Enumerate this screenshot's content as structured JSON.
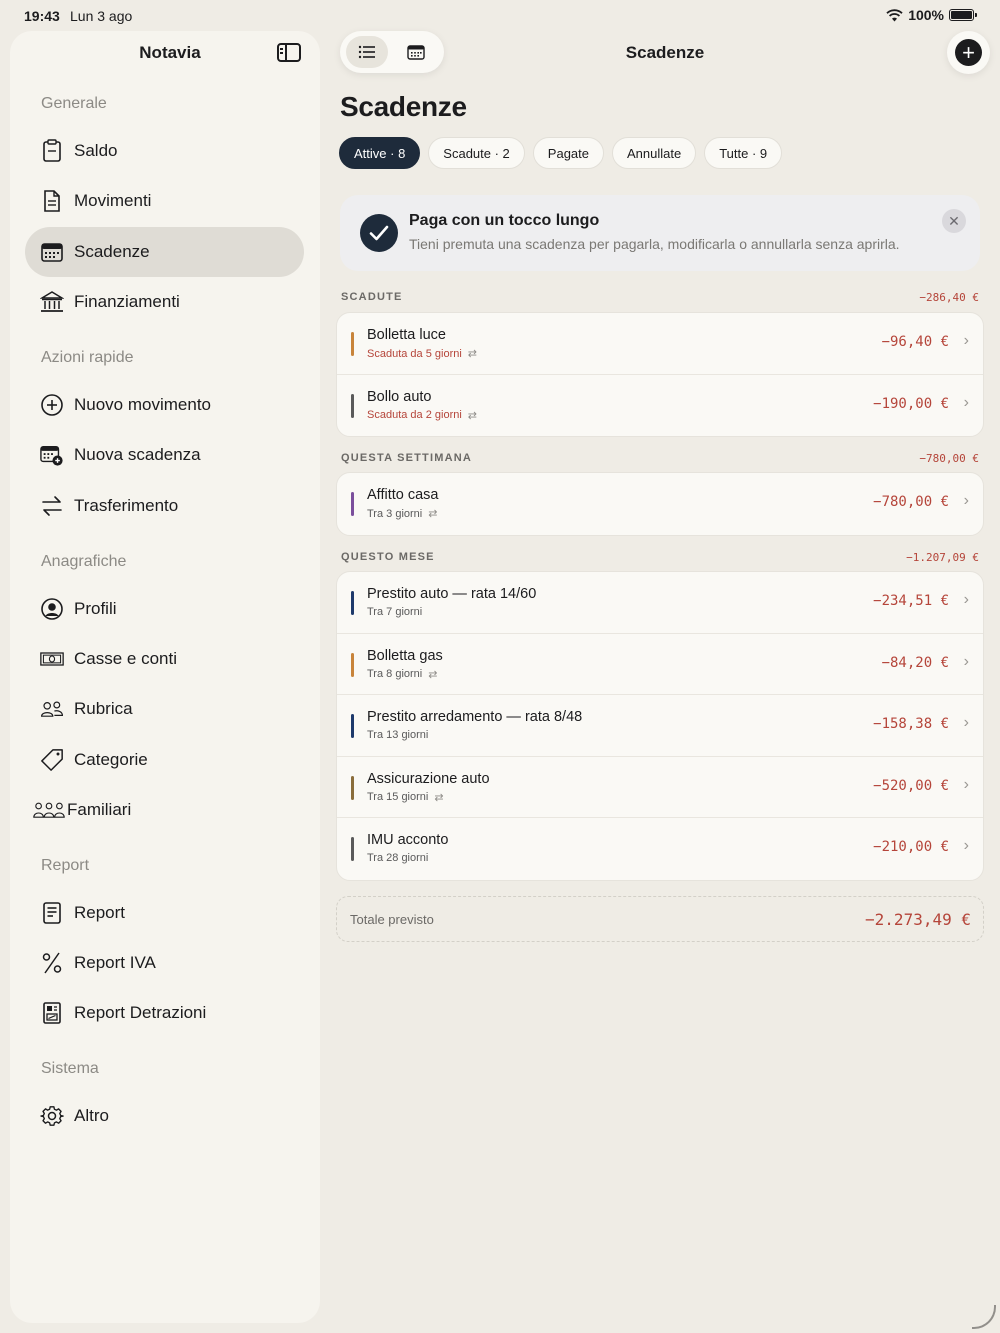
{
  "status_bar": {
    "time": "19:43",
    "date": "Lun 3 ago",
    "battery": "100%"
  },
  "sidebar": {
    "title": "Notavia",
    "sections": [
      {
        "label": "Generale",
        "items": [
          {
            "label": "Saldo",
            "icon": "wallet-icon",
            "active": false
          },
          {
            "label": "Movimenti",
            "icon": "document-icon",
            "active": false
          },
          {
            "label": "Scadenze",
            "icon": "calendar-icon",
            "active": true
          },
          {
            "label": "Finanziamenti",
            "icon": "bank-icon",
            "active": false
          }
        ]
      },
      {
        "label": "Azioni rapide",
        "items": [
          {
            "label": "Nuovo movimento",
            "icon": "plus-circle-icon"
          },
          {
            "label": "Nuova scadenza",
            "icon": "calendar-plus-icon"
          },
          {
            "label": "Trasferimento",
            "icon": "transfer-arrows-icon"
          }
        ]
      },
      {
        "label": "Anagrafiche",
        "items": [
          {
            "label": "Profili",
            "icon": "person-circle-icon"
          },
          {
            "label": "Casse e conti",
            "icon": "banknote-icon"
          },
          {
            "label": "Rubrica",
            "icon": "people-icon"
          },
          {
            "label": "Categorie",
            "icon": "tag-icon"
          },
          {
            "label": "Familiari",
            "icon": "family-icon"
          }
        ]
      },
      {
        "label": "Report",
        "items": [
          {
            "label": "Report",
            "icon": "report-icon"
          },
          {
            "label": "Report IVA",
            "icon": "percent-icon"
          },
          {
            "label": "Report Detrazioni",
            "icon": "receipt-icon"
          }
        ]
      },
      {
        "label": "Sistema",
        "items": [
          {
            "label": "Altro",
            "icon": "gear-icon"
          }
        ]
      }
    ]
  },
  "header": {
    "title": "Scadenze",
    "page_title": "Scadenze"
  },
  "filters": [
    {
      "label": "Attive · 8",
      "active": true
    },
    {
      "label": "Scadute · 2",
      "active": false
    },
    {
      "label": "Pagate",
      "active": false
    },
    {
      "label": "Annullate",
      "active": false
    },
    {
      "label": "Tutte · 9",
      "active": false
    }
  ],
  "tip": {
    "title": "Paga con un tocco lungo",
    "text": "Tieni premuta una scadenza per pagarla, modificarla o annullarla senza aprirla."
  },
  "groups": [
    {
      "label": "SCADUTE",
      "total": "−286,40 €",
      "items": [
        {
          "name": "Bolletta luce",
          "sub": "Scaduta da 5 giorni",
          "overdue": true,
          "recurring": true,
          "amount": "−96,40 €",
          "color": "#c8843a"
        },
        {
          "name": "Bollo auto",
          "sub": "Scaduta da 2 giorni",
          "overdue": true,
          "recurring": true,
          "amount": "−190,00 €",
          "color": "#5a5a5a"
        }
      ]
    },
    {
      "label": "QUESTA SETTIMANA",
      "total": "−780,00 €",
      "items": [
        {
          "name": "Affitto casa",
          "sub": "Tra 3 giorni",
          "overdue": false,
          "recurring": true,
          "amount": "−780,00 €",
          "color": "#7b4f9c"
        }
      ]
    },
    {
      "label": "QUESTO MESE",
      "total": "−1.207,09 €",
      "items": [
        {
          "name": "Prestito auto — rata 14/60",
          "sub": "Tra 7 giorni",
          "overdue": false,
          "recurring": false,
          "amount": "−234,51 €",
          "color": "#1e3a6b"
        },
        {
          "name": "Bolletta gas",
          "sub": "Tra 8 giorni",
          "overdue": false,
          "recurring": true,
          "amount": "−84,20 €",
          "color": "#c8843a"
        },
        {
          "name": "Prestito arredamento — rata 8/48",
          "sub": "Tra 13 giorni",
          "overdue": false,
          "recurring": false,
          "amount": "−158,38 €",
          "color": "#1e3a6b"
        },
        {
          "name": "Assicurazione auto",
          "sub": "Tra 15 giorni",
          "overdue": false,
          "recurring": true,
          "amount": "−520,00 €",
          "color": "#8a6d3b"
        },
        {
          "name": "IMU acconto",
          "sub": "Tra 28 giorni",
          "overdue": false,
          "recurring": false,
          "amount": "−210,00 €",
          "color": "#5a5a5a"
        }
      ]
    }
  ],
  "total_preview": {
    "label": "Totale previsto",
    "value": "−2.273,49 €"
  }
}
